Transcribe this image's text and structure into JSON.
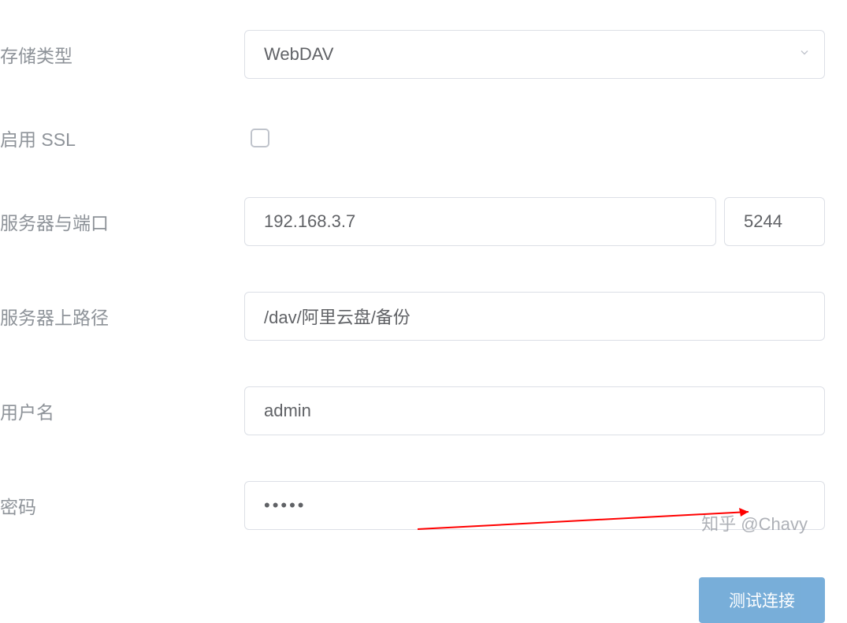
{
  "form": {
    "storage_type": {
      "label": "存储类型",
      "value": "WebDAV"
    },
    "enable_ssl": {
      "label": "启用 SSL",
      "checked": false
    },
    "server_port": {
      "label": "服务器与端口",
      "server": "192.168.3.7",
      "port": "5244"
    },
    "server_path": {
      "label": "服务器上路径",
      "value": "/dav/阿里云盘/备份"
    },
    "username": {
      "label": "用户名",
      "value": "admin"
    },
    "password": {
      "label": "密码",
      "value": "•••••"
    }
  },
  "button": {
    "submit": "测试连接"
  },
  "watermark": "知乎 @Chavy"
}
